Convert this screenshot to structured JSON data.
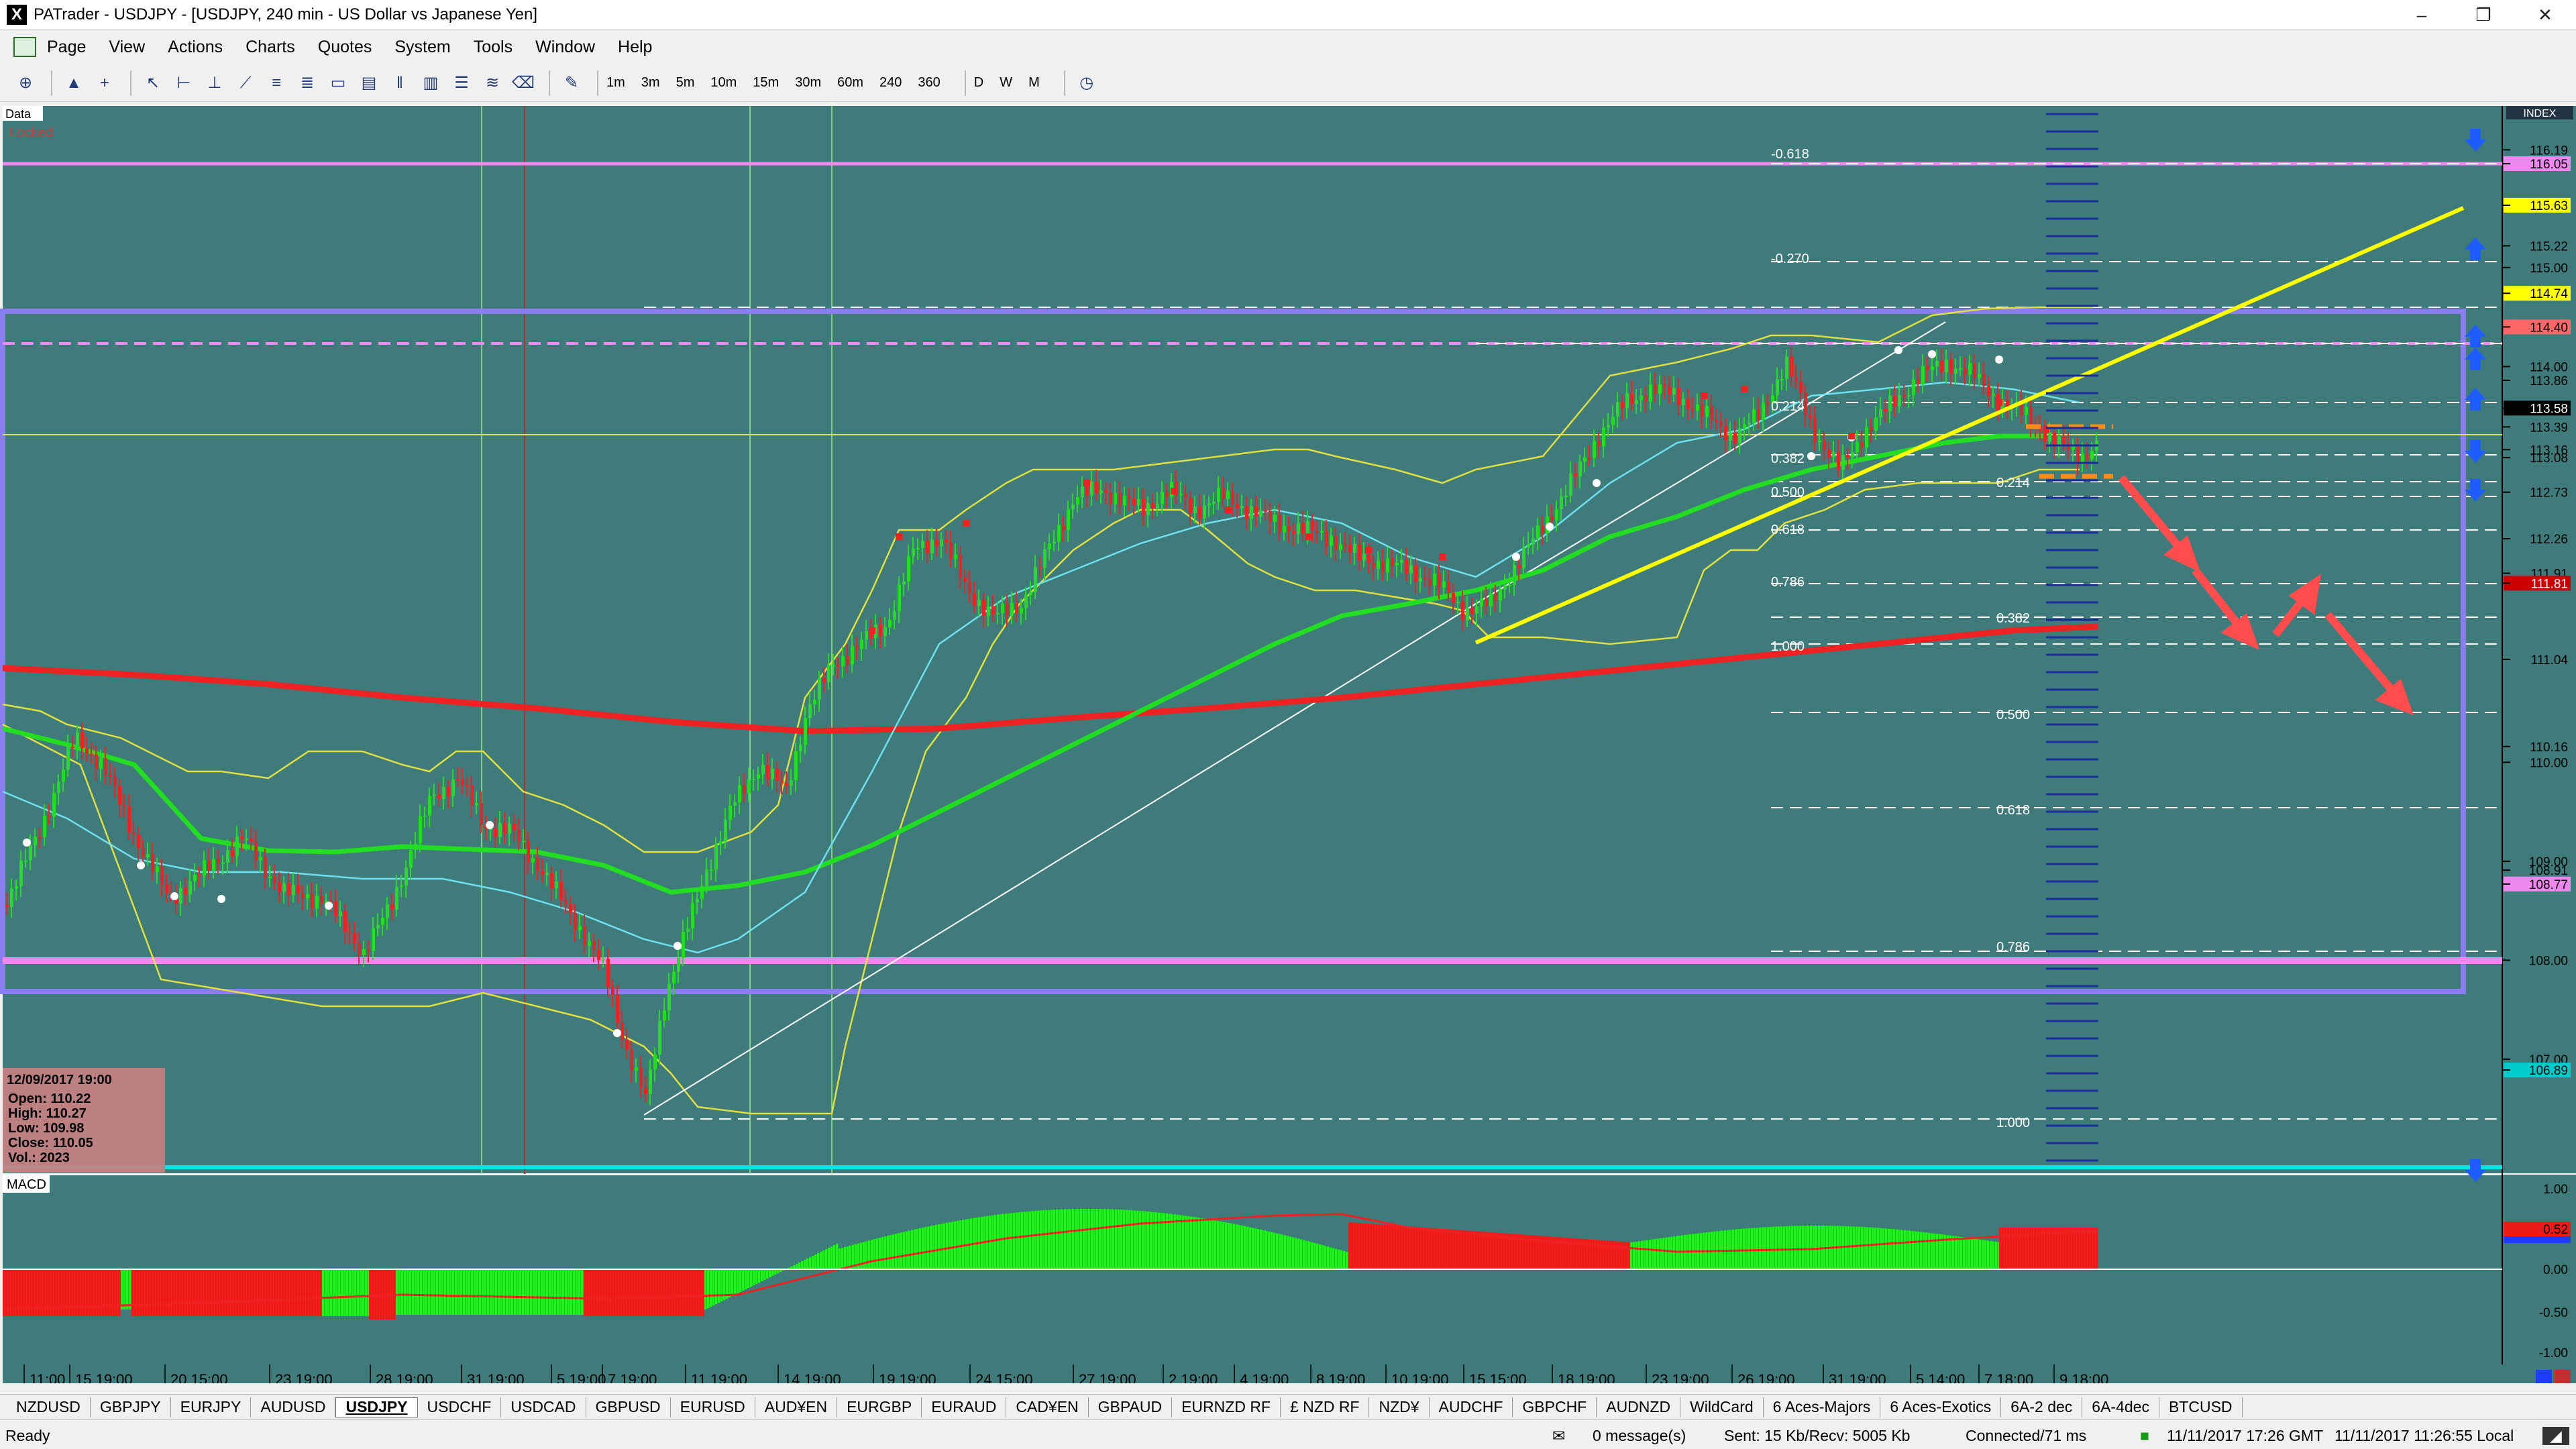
{
  "app": {
    "title": "PATrader - USDJPY - [USDJPY, 240 min - US Dollar vs Japanese Yen]",
    "icon": "x-logo-icon"
  },
  "window_controls": {
    "minimize": "–",
    "restore": "❐",
    "close": "✕"
  },
  "mdi_controls": {
    "minimize": "_",
    "restore": "❐",
    "close": "✕"
  },
  "menu": [
    "Page",
    "View",
    "Actions",
    "Charts",
    "Quotes",
    "System",
    "Tools",
    "Window",
    "Help"
  ],
  "toolbar": {
    "timeframes": [
      "1m",
      "3m",
      "5m",
      "10m",
      "15m",
      "30m",
      "60m",
      "240",
      "360"
    ],
    "periods": [
      "D",
      "W",
      "M"
    ]
  },
  "chart": {
    "labels": {
      "data": "Data",
      "locked": "Locked",
      "index": "INDEX",
      "macd": "MACD"
    },
    "price_axis": [
      "116.19",
      "116.05",
      "115.63",
      "115.22",
      "115.00",
      "114.74",
      "114.40",
      "114.00",
      "113.86",
      "113.58",
      "113.39",
      "113.16",
      "113.08",
      "112.73",
      "112.26",
      "111.91",
      "111.81",
      "111.04",
      "110.16",
      "110.00",
      "109.00",
      "108.91",
      "108.77",
      "108.00",
      "107.00",
      "106.89"
    ],
    "price_highlight": {
      "115.63": "#ffff00",
      "114.74": "#ffff00",
      "114.40": "#ff6666",
      "113.58": "#000000",
      "111.81": "#cc0000",
      "116.05": "#ee88ee",
      "108.77": "#ee88ee",
      "106.89": "#00cccc"
    },
    "macd_axis": [
      "1.00",
      "0.52",
      "0.00",
      "-0.50",
      "-1.00"
    ],
    "time_axis": [
      "11:00",
      "15 19:00",
      "20 15:00",
      "23 19:00",
      "28 19:00",
      "31 19:00",
      "5 19:00",
      "7 19:00",
      "11 19:00",
      "14 19:00",
      "19 19:00",
      "24 15:00",
      "27 19:00",
      "2 19:00",
      "4 19:00",
      "8 19:00",
      "10 19:00",
      "15 15:00",
      "18 19:00",
      "23 19:00",
      "26 19:00",
      "31 19:00",
      "5 14:00",
      "7 18:00",
      "9 18:00"
    ],
    "fib_labels_left": [
      "-0.618",
      "-0.270",
      "0.214",
      "0.382",
      "0.500",
      "0.618",
      "0.786",
      "1.000"
    ],
    "fib_labels_right": [
      "0.214",
      "0.382",
      "0.500",
      "0.618",
      "0.786",
      "1.000"
    ],
    "info_box": {
      "date": "12/09/2017 19:00",
      "open": "Open: 110.22",
      "high": "High: 110.27",
      "low": "Low: 109.98",
      "close": "Close: 110.05",
      "vol": "Vol.: 2023"
    }
  },
  "symbol_tabs": [
    "NZDUSD",
    "GBPJPY",
    "EURJPY",
    "AUDUSD",
    "USDJPY",
    "USDCHF",
    "USDCAD",
    "GBPUSD",
    "EURUSD",
    "AUD¥EN",
    "EURGBP",
    "EURAUD",
    "CAD¥EN",
    "GBPAUD",
    "EURNZD RF",
    "£ NZD RF",
    "NZD¥",
    "AUDCHF",
    "GBPCHF",
    "AUDNZD",
    "WildCard",
    "6 Aces-Majors",
    "6 Aces-Exotics",
    "6A-2 dec",
    "6A-4dec",
    "BTCUSD"
  ],
  "active_tab": "USDJPY",
  "status": {
    "ready": "Ready",
    "messages": "0 message(s)",
    "traffic": "Sent: 15 Kb/Recv: 5005 Kb",
    "connected": "Connected/71 ms",
    "gmt": "11/11/2017 17:26 GMT",
    "local": "11/11/2017 11:26:55 Local"
  }
}
